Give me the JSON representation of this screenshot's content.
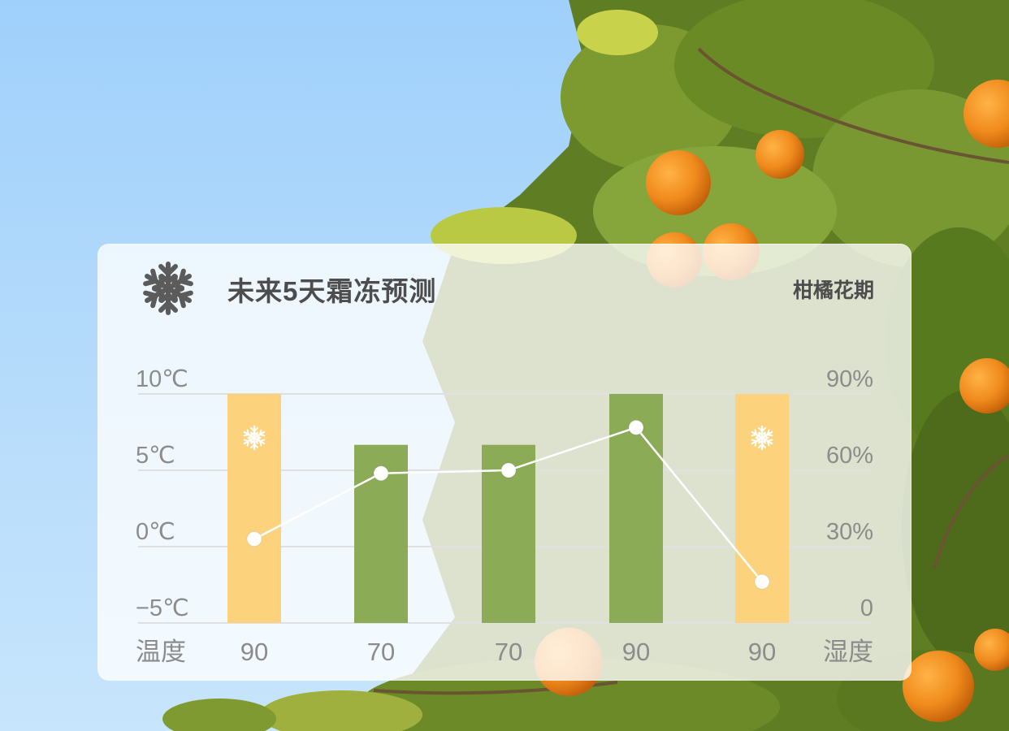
{
  "card": {
    "title": "未来5天霜冻预测",
    "subtitle": "柑橘花期",
    "icon": "snowflake-icon"
  },
  "chart_data": {
    "type": "bar+line",
    "title": "未来5天霜冻预测",
    "subtitle": "柑橘花期",
    "left_axis": {
      "label": "温度",
      "unit": "℃",
      "ticks": [
        "10℃",
        "5℃",
        "0℃",
        "−5℃"
      ],
      "ylim": [
        -5,
        10
      ]
    },
    "right_axis": {
      "label": "湿度",
      "unit": "%",
      "ticks": [
        "90%",
        "60%",
        "30%",
        "0"
      ],
      "ylim": [
        0,
        90
      ]
    },
    "categories": [
      "90",
      "70",
      "70",
      "90",
      "90"
    ],
    "bars": {
      "axis": "right",
      "values": [
        90,
        70,
        70,
        90,
        90
      ],
      "frost": [
        true,
        false,
        false,
        false,
        true
      ],
      "colors": {
        "frost": "#fcd27d",
        "normal": "#8bab57"
      }
    },
    "line": {
      "axis": "left",
      "values": [
        0.5,
        4.8,
        5.0,
        7.8,
        -2.3
      ],
      "color": "#ffffff"
    },
    "frost_icon": "snowflake-icon",
    "grid": true,
    "colors": {
      "card_background": "#ffffff",
      "text_dark": "#4d4d4d",
      "text_gray": "#8c8c8c",
      "grid": "#e0e0e0",
      "sky": "#a4d2fb",
      "orange": "#f08a1c",
      "leaf": "#6f8b2a"
    }
  }
}
